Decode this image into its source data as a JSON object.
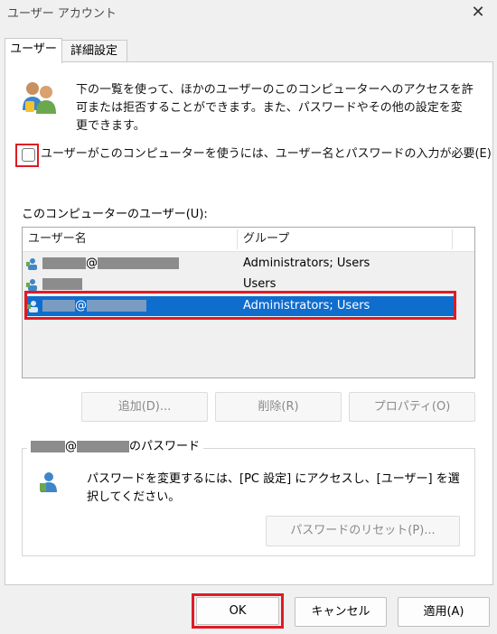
{
  "window": {
    "title": "ユーザー アカウント",
    "close_glyph": "✕"
  },
  "tabs": [
    {
      "label": "ユーザー",
      "active": true
    },
    {
      "label": "詳細設定",
      "active": false
    }
  ],
  "description": "下の一覧を使って、ほかのユーザーのこのコンピューターへのアクセスを許可または拒否することができます。また、パスワードやその他の設定を変更できます。",
  "require_login": {
    "label": "ユーザーがこのコンピューターを使うには、ユーザー名とパスワードの入力が必要(E)",
    "checked": false
  },
  "users": {
    "label": "このコンピューターのユーザー(U):",
    "columns": [
      "ユーザー名",
      "グループ"
    ],
    "rows": [
      {
        "at": "@",
        "group": "Administrators; Users",
        "selected": false
      },
      {
        "at": "",
        "group": "Users",
        "selected": false
      },
      {
        "at": "@",
        "group": "Administrators; Users",
        "selected": true
      }
    ]
  },
  "buttons": {
    "add": "追加(D)...",
    "remove": "削除(R)",
    "properties": "プロパティ(O)"
  },
  "password_group": {
    "at": "@",
    "title_suffix": "のパスワード",
    "text": "パスワードを変更するには、[PC 設定] にアクセスし、[ユーザー] を選択してください。",
    "reset": "パスワードのリセット(P)..."
  },
  "footer": {
    "ok": "OK",
    "cancel": "キャンセル",
    "apply": "適用(A)"
  },
  "colors": {
    "highlight": "#0f6dce",
    "annotation": "#e01b24"
  }
}
